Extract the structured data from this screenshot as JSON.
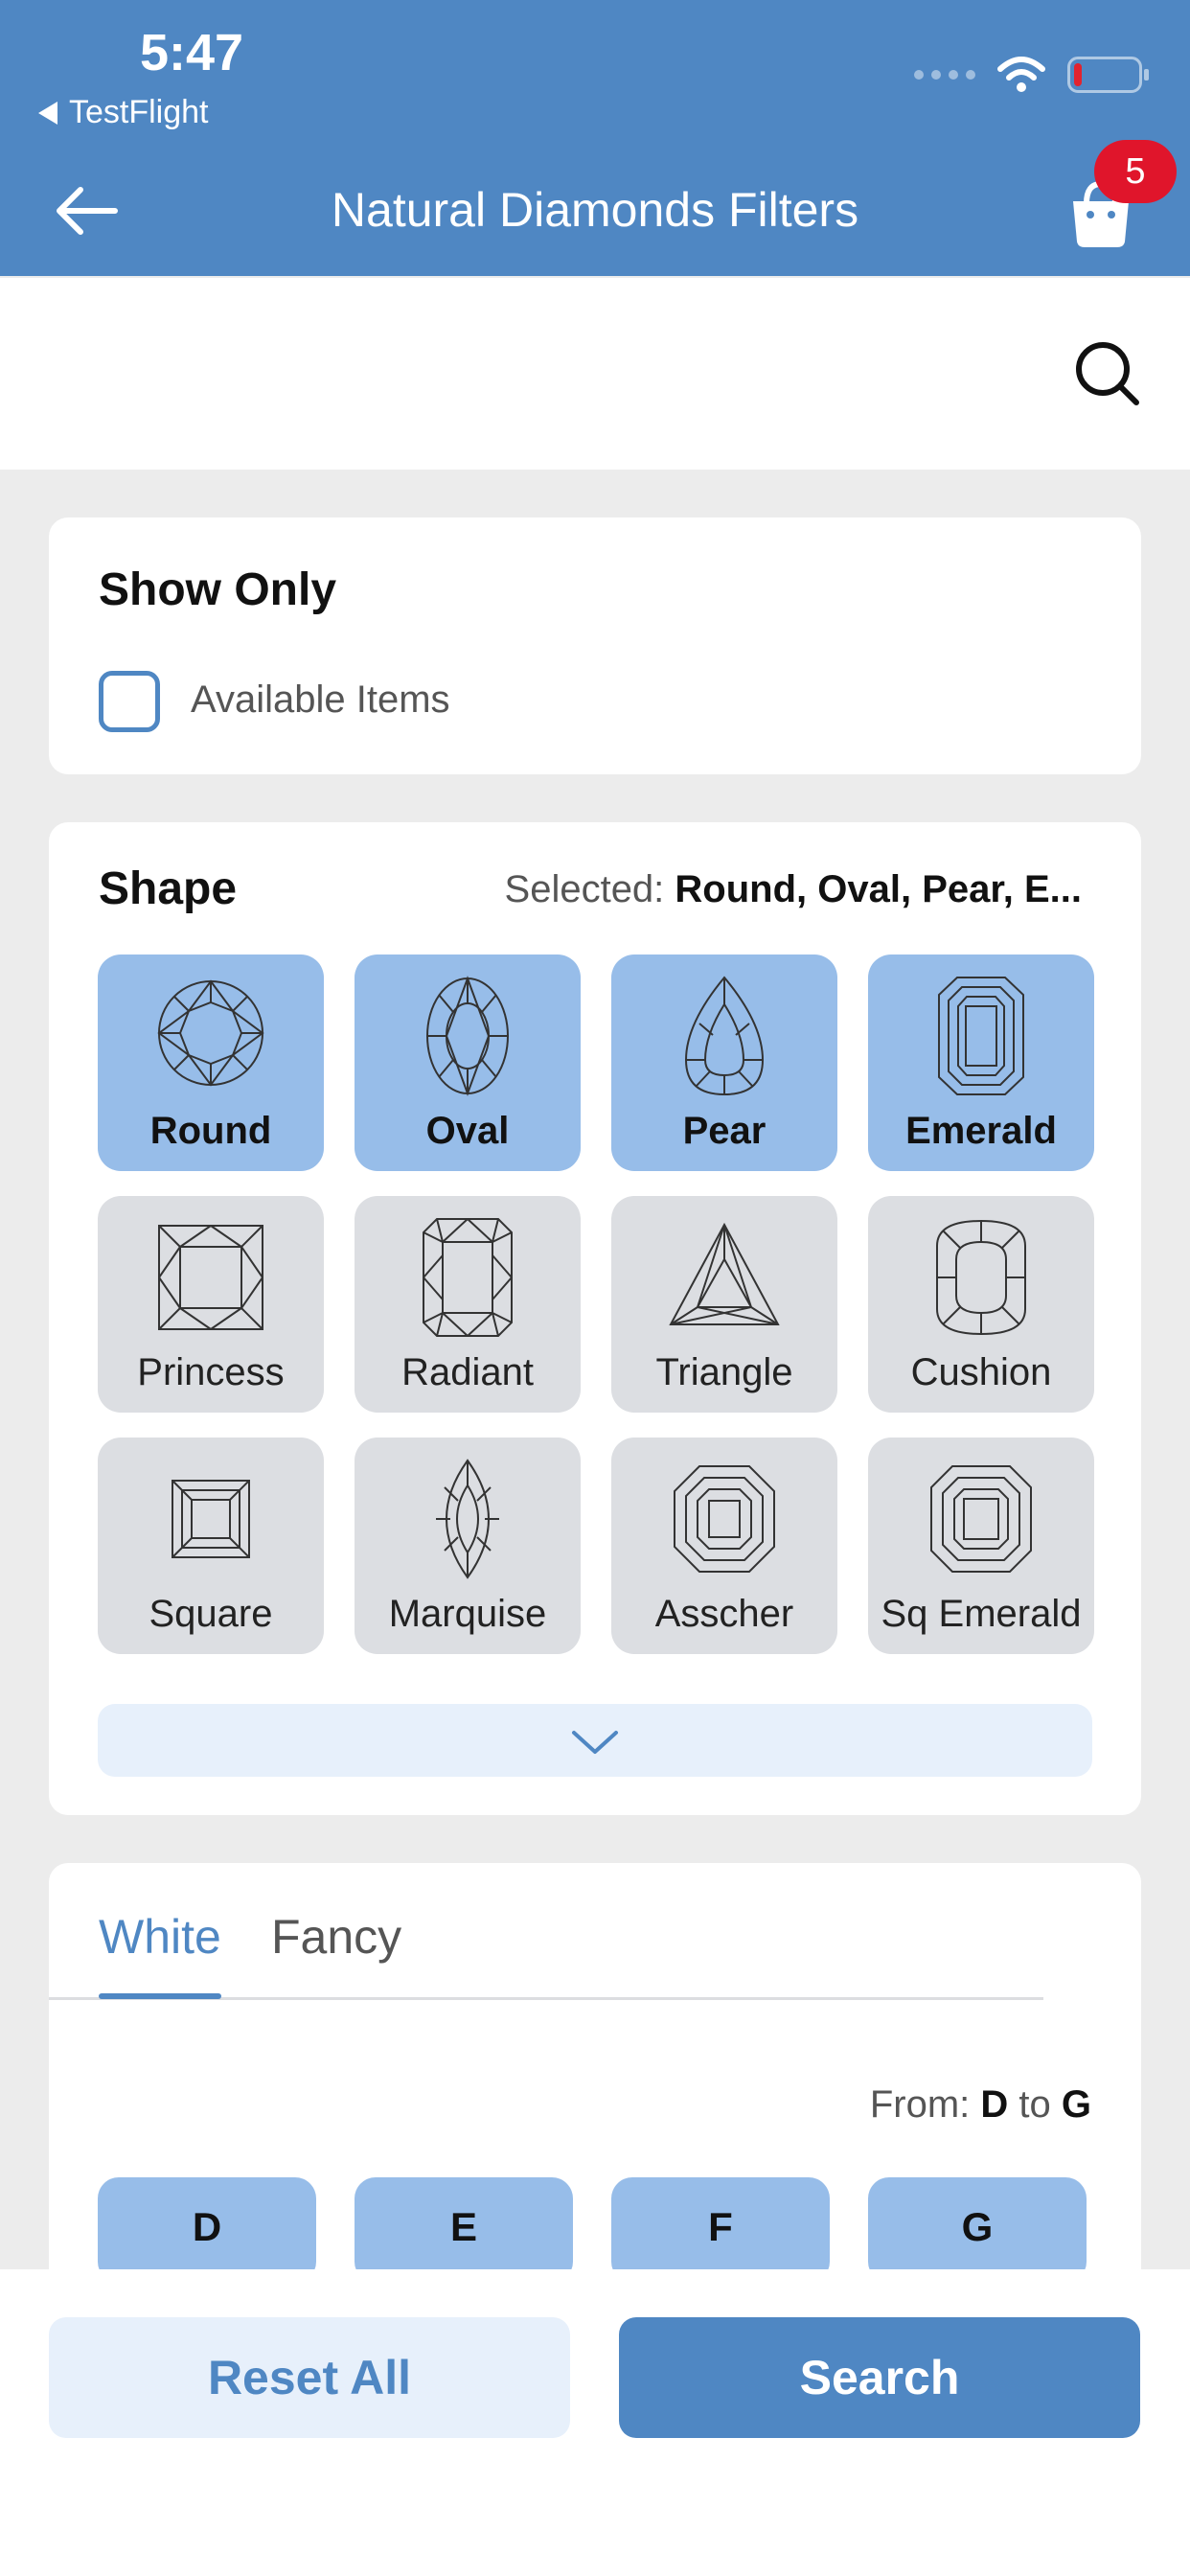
{
  "status_bar": {
    "time": "5:47",
    "back_app": "TestFlight",
    "battery_level": 0.12
  },
  "header": {
    "title": "Natural Diamonds Filters",
    "cart_count": "5",
    "icons": [
      "back-arrow-icon",
      "shopping-bag-icon",
      "search-icon"
    ]
  },
  "show_only": {
    "title": "Show Only",
    "available_label": "Available Items",
    "available_checked": false
  },
  "shape": {
    "title": "Shape",
    "selected_prefix": "Selected:",
    "selected_value": "Round, Oval, Pear, E...",
    "items": [
      {
        "label": "Round",
        "selected": true
      },
      {
        "label": "Oval",
        "selected": true
      },
      {
        "label": "Pear",
        "selected": true
      },
      {
        "label": "Emerald",
        "selected": true
      },
      {
        "label": "Princess",
        "selected": false
      },
      {
        "label": "Radiant",
        "selected": false
      },
      {
        "label": "Triangle",
        "selected": false
      },
      {
        "label": "Cushion",
        "selected": false
      },
      {
        "label": "Square",
        "selected": false
      },
      {
        "label": "Marquise",
        "selected": false
      },
      {
        "label": "Asscher",
        "selected": false
      },
      {
        "label": "Sq Emerald",
        "selected": false
      }
    ]
  },
  "color": {
    "tabs": [
      {
        "label": "White",
        "active": true
      },
      {
        "label": "Fancy",
        "active": false
      }
    ],
    "from_prefix": "From:",
    "from_value": "D",
    "to_word": "to",
    "to_value": "G",
    "chips": [
      "D",
      "E",
      "F",
      "G"
    ]
  },
  "actions": {
    "reset_label": "Reset All",
    "search_label": "Search"
  },
  "colors": {
    "primary": "#4f87c3",
    "selected_tile": "#97bde9",
    "badge": "#e0152b"
  }
}
